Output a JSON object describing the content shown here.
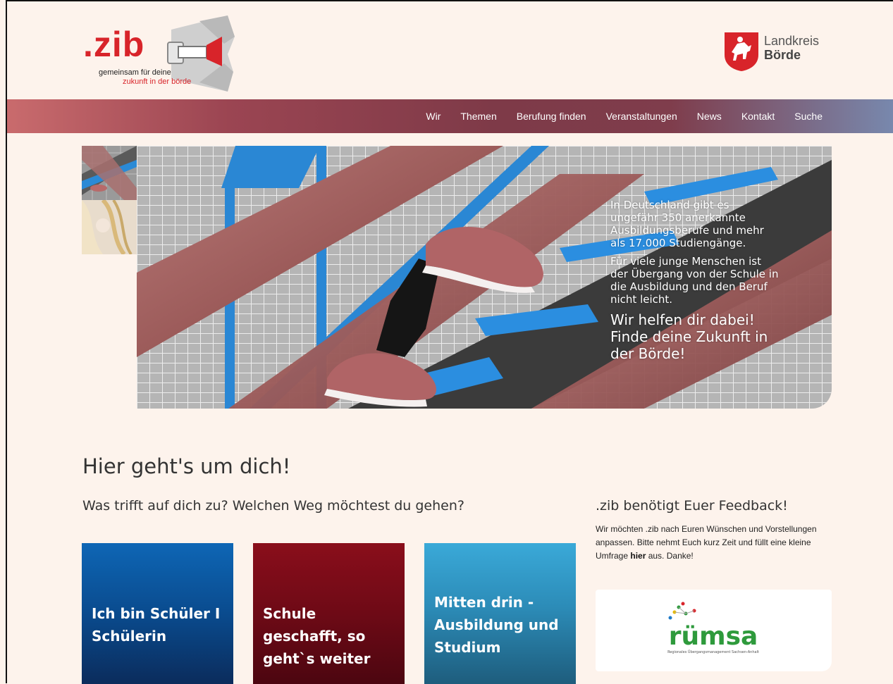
{
  "header": {
    "logo_main": ".zib",
    "logo_line1": "gemeinsam für deine",
    "logo_line2": "zukunft in der börde",
    "district_line1": "Landkreis",
    "district_line2": "Börde"
  },
  "nav": {
    "items": [
      "Wir",
      "Themen",
      "Berufung finden",
      "Veranstaltungen",
      "News",
      "Kontakt",
      "Suche"
    ]
  },
  "hero": {
    "p1": "In Deutschland gibt es ungefähr 350 anerkannte Ausbildungsberufe und mehr als 17.000 Studiengänge.",
    "p2": "Für viele junge Menschen ist der Übergang von der Schule in die Ausbildung und den Beruf nicht leicht.",
    "p3": "Wir helfen dir dabei! Finde deine Zukunft in der Börde!"
  },
  "main": {
    "heading": "Hier geht's um dich!",
    "subheading": "Was trifft auf dich zu? Welchen Weg möchtest du gehen?",
    "cards": [
      {
        "label": "Ich bin Schüler I Schülerin"
      },
      {
        "label": "Schule geschafft, so geht`s weiter"
      },
      {
        "label": "Mitten drin - Ausbildung und Studium"
      }
    ]
  },
  "feedback": {
    "title": ".zib benötigt Euer Feedback!",
    "text_before": "Wir möchten .zib nach Euren Wünschen und Vorstellungen anpassen. Bitte nehmt Euch kurz Zeit und füllt eine kleine Umfrage ",
    "link": "hier",
    "text_after": " aus. Danke!",
    "partner_logo": "rümsa",
    "partner_subtitle": "Regionales Übergangsmanagement Sachsen-Anhalt"
  },
  "colors": {
    "accent_red": "#d8242a",
    "card1": "#0a4b8e",
    "card2": "#6e0a16",
    "card3": "#2c8cb8",
    "ruemsa_green": "#2e9a3c"
  }
}
